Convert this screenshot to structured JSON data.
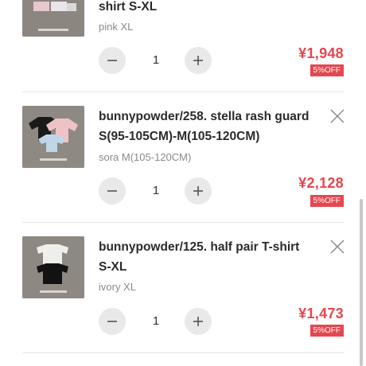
{
  "cart": {
    "items": [
      {
        "title": "shirt S-XL",
        "variant": "pink XL",
        "quantity": "1",
        "price": "¥1,948",
        "discount": "5%OFF",
        "thumb_icon": "pink-shirts-product-photo"
      },
      {
        "title": "bunnypowder/258. stella rash guard S(95-105CM)-M(105-120CM)",
        "variant": "sora M(105-120CM)",
        "quantity": "1",
        "price": "¥2,128",
        "discount": "5%OFF",
        "thumb_icon": "rash-guard-product-photo"
      },
      {
        "title": "bunnypowder/125. half pair T-shirt S-XL",
        "variant": "ivory XL",
        "quantity": "1",
        "price": "¥1,473",
        "discount": "5%OFF",
        "thumb_icon": "tshirt-product-photo"
      }
    ]
  },
  "colors": {
    "price": "#e5474f",
    "badge_bg": "#e5474f",
    "qty_button_bg": "#e9e9e9",
    "divider": "#e6e6e6"
  }
}
